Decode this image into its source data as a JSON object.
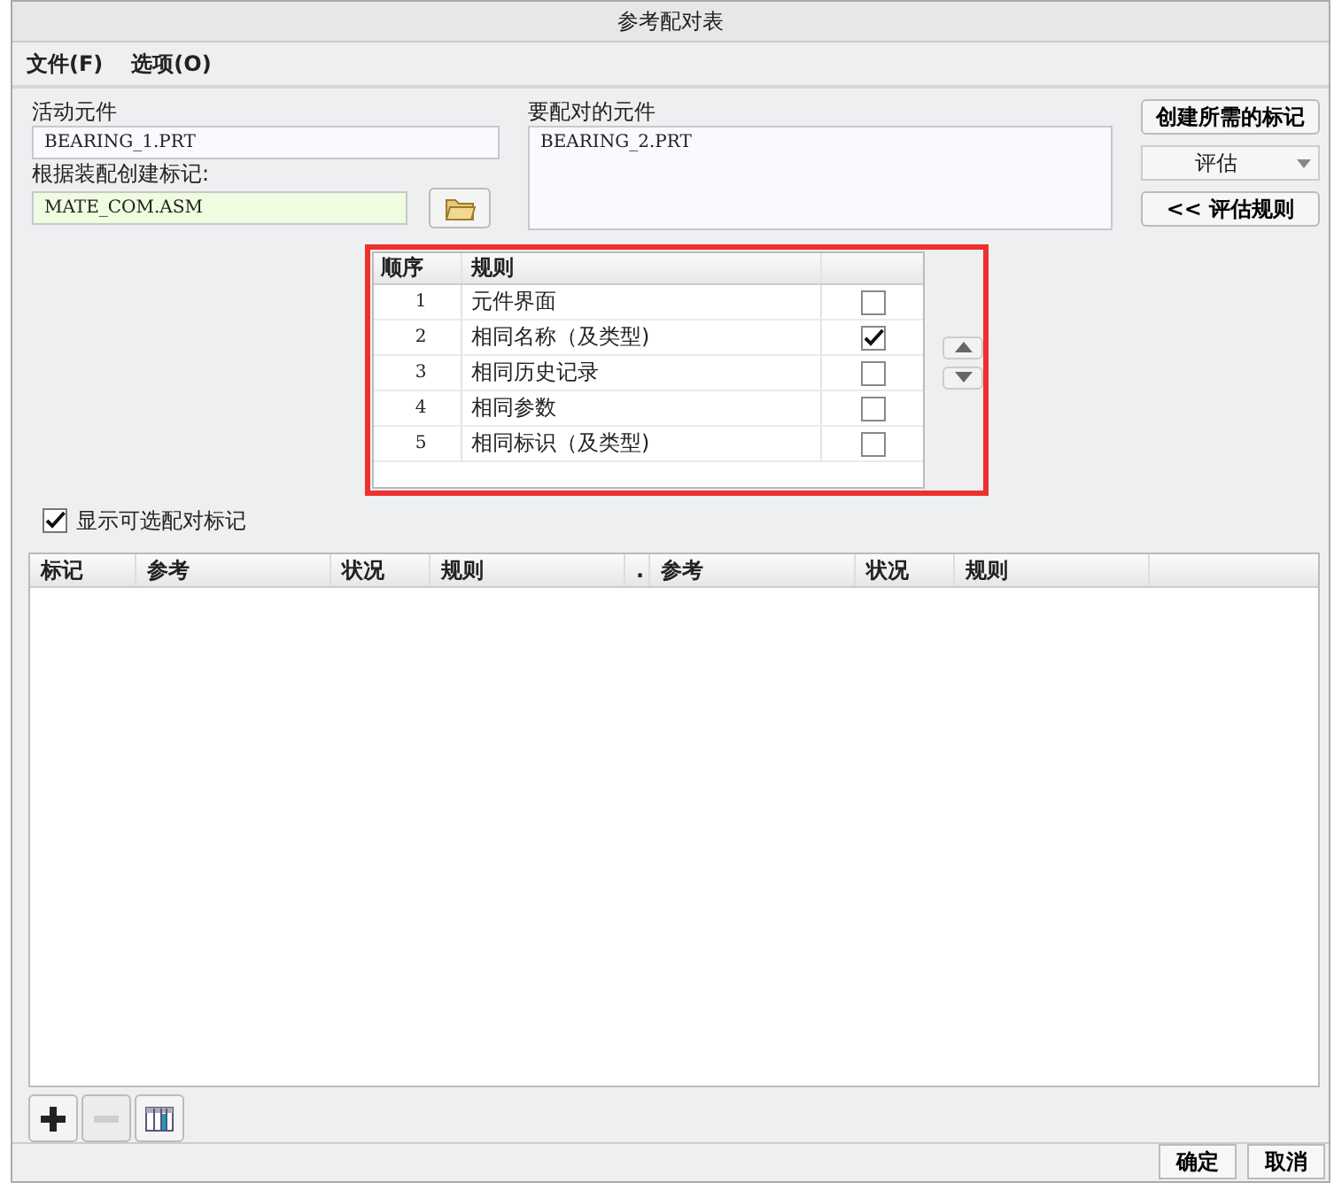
{
  "window": {
    "title": "参考配对表"
  },
  "menu": [
    "文件(F)",
    "选项(O)"
  ],
  "active_component": {
    "label": "活动元件",
    "value": "BEARING_1.PRT"
  },
  "assembly_mark": {
    "label": "根据装配创建标记:",
    "value": "MATE_COM.ASM"
  },
  "target_component": {
    "label": "要配对的元件",
    "value": "BEARING_2.PRT"
  },
  "buttons": {
    "create": "创建所需的标记",
    "evaluate": "评估",
    "rules": "<< 评估规则"
  },
  "rules_table": {
    "columns": [
      "顺序",
      "规则"
    ],
    "rows": [
      {
        "order": "1",
        "rule": "元件界面",
        "checked": false
      },
      {
        "order": "2",
        "rule": "相同名称（及类型)",
        "checked": true
      },
      {
        "order": "3",
        "rule": "相同历史记录",
        "checked": false
      },
      {
        "order": "4",
        "rule": "相同参数",
        "checked": false
      },
      {
        "order": "5",
        "rule": "相同标识（及类型)",
        "checked": false
      }
    ]
  },
  "show_optional": {
    "label": "显示可选配对标记",
    "checked": true
  },
  "mark_table": {
    "columns": [
      "标记",
      "参考",
      "状况",
      "规则",
      ".",
      "参考",
      "状况",
      "规则"
    ]
  },
  "toolbar": [
    {
      "kind": "add",
      "disabled": false
    },
    {
      "kind": "remove",
      "disabled": true
    },
    {
      "kind": "columns",
      "disabled": false
    }
  ],
  "footer": [
    "确定",
    "取消"
  ]
}
